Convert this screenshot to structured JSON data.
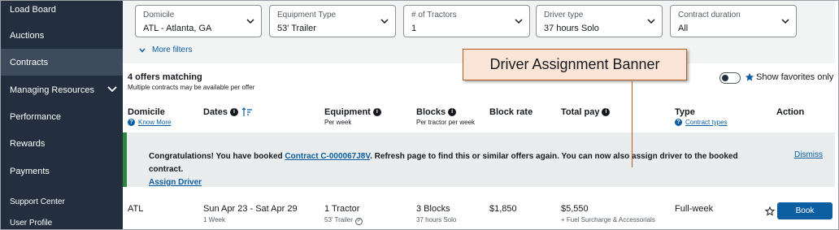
{
  "sidebar": {
    "items": [
      {
        "label": "Load Board"
      },
      {
        "label": "Auctions"
      },
      {
        "label": "Contracts"
      },
      {
        "label": "Managing Resources"
      },
      {
        "label": "Performance"
      },
      {
        "label": "Rewards"
      },
      {
        "label": "Payments"
      },
      {
        "label": "Support Center"
      },
      {
        "label": "User Profile"
      }
    ],
    "active": "Contracts"
  },
  "filters": [
    {
      "label": "Domicile",
      "value": "ATL - Atlanta, GA"
    },
    {
      "label": "Equipment Type",
      "value": "53' Trailer"
    },
    {
      "label": "# of Tractors",
      "value": "1"
    },
    {
      "label": "Driver type",
      "value": "37 hours Solo"
    },
    {
      "label": "Contract duration",
      "value": "All"
    }
  ],
  "more_filters": "More filters",
  "offers": {
    "title": "4 offers matching",
    "subtitle": "Multiple contracts may be available per offer"
  },
  "favorites": {
    "label": "Show favorites only"
  },
  "columns": {
    "domicile": "Domicile",
    "domicile_link": "Know More",
    "dates": "Dates",
    "equipment": "Equipment",
    "equipment_sub": "Per week",
    "blocks": "Blocks",
    "blocks_sub": "Per tractor per week",
    "block_rate": "Block rate",
    "total_pay": "Total pay",
    "type": "Type",
    "type_link": "Contract types",
    "action": "Action"
  },
  "banner": {
    "text_before": "Congratulations! You have booked ",
    "contract_link": "Contract C-000067J8V",
    "text_after": ". Refresh page to find this or similar offers again. You can now also assign driver to the booked contract.",
    "assign_link": "Assign Driver",
    "dismiss": "Dismiss"
  },
  "row": {
    "domicile": "ATL",
    "dates": "Sun Apr 23 - Sat Apr 29",
    "dates_sub": "1 Week",
    "equipment": "1 Tractor",
    "equipment_sub": "53' Trailer",
    "equipment_badge": "P",
    "blocks": "3 Blocks",
    "blocks_sub": "37 hours Solo",
    "block_rate": "$1,850",
    "total_pay": "$5,550",
    "total_pay_sub": "+ Fuel Surcharge & Accessorials",
    "type": "Full-week",
    "book_label": "Book"
  },
  "callout": {
    "label": "Driver Assignment Banner"
  },
  "colors": {
    "sidebar_bg": "#232f3e",
    "sidebar_active": "#3d4b5c",
    "link": "#0b5ea1",
    "banner_accent": "#2e8540",
    "callout_bg": "#fbe5d6"
  }
}
